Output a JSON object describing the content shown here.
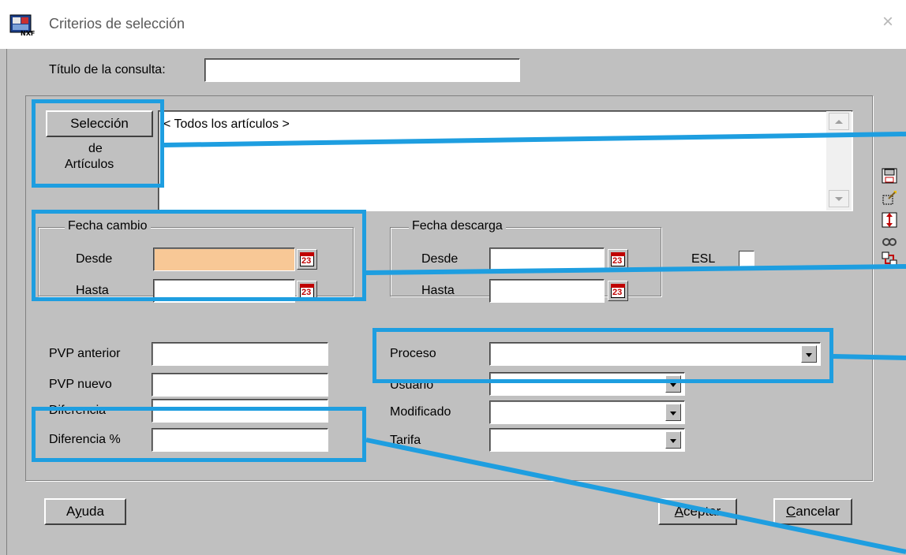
{
  "window": {
    "title": "Criterios de selección",
    "close_glyph": "×"
  },
  "query": {
    "title_label": "Título de la consulta:",
    "title_value": ""
  },
  "articles": {
    "button_label": "Selección",
    "caption_line1": "de",
    "caption_line2": "Artículos",
    "selection_text": "< Todos los artículos >"
  },
  "fecha_cambio": {
    "group_title": "Fecha cambio",
    "desde_label": "Desde",
    "hasta_label": "Hasta",
    "desde_value": "",
    "hasta_value": ""
  },
  "fecha_descarga": {
    "group_title": "Fecha descarga",
    "desde_label": "Desde",
    "hasta_label": "Hasta",
    "desde_value": "",
    "hasta_value": ""
  },
  "esl": {
    "label": "ESL"
  },
  "calendar_icon_text": "23",
  "prices": {
    "pvp_anterior_label": "PVP anterior",
    "pvp_nuevo_label": "PVP nuevo",
    "diferencia_label": "Diferencia",
    "diferencia_pct_label": "Diferencia %"
  },
  "filters": {
    "proceso_label": "Proceso",
    "usuario_label": "Usuario",
    "modificado_label": "Modificado",
    "tarifa_label": "Tarifa"
  },
  "buttons": {
    "ayuda_first": "A",
    "ayuda_underline": "y",
    "ayuda_rest": "uda",
    "aceptar_underline": "A",
    "aceptar_rest": "ceptar",
    "cancelar_underline": "C",
    "cancelar_rest": "ancelar"
  },
  "toolbar_icons": [
    "save-icon",
    "clear-icon",
    "resize-icon",
    "link-icon",
    "transfer-icon"
  ],
  "colors": {
    "highlight_field": "#f8c896",
    "annotation": "#1e9ee0",
    "dialog_bg": "#c0c0c0"
  }
}
